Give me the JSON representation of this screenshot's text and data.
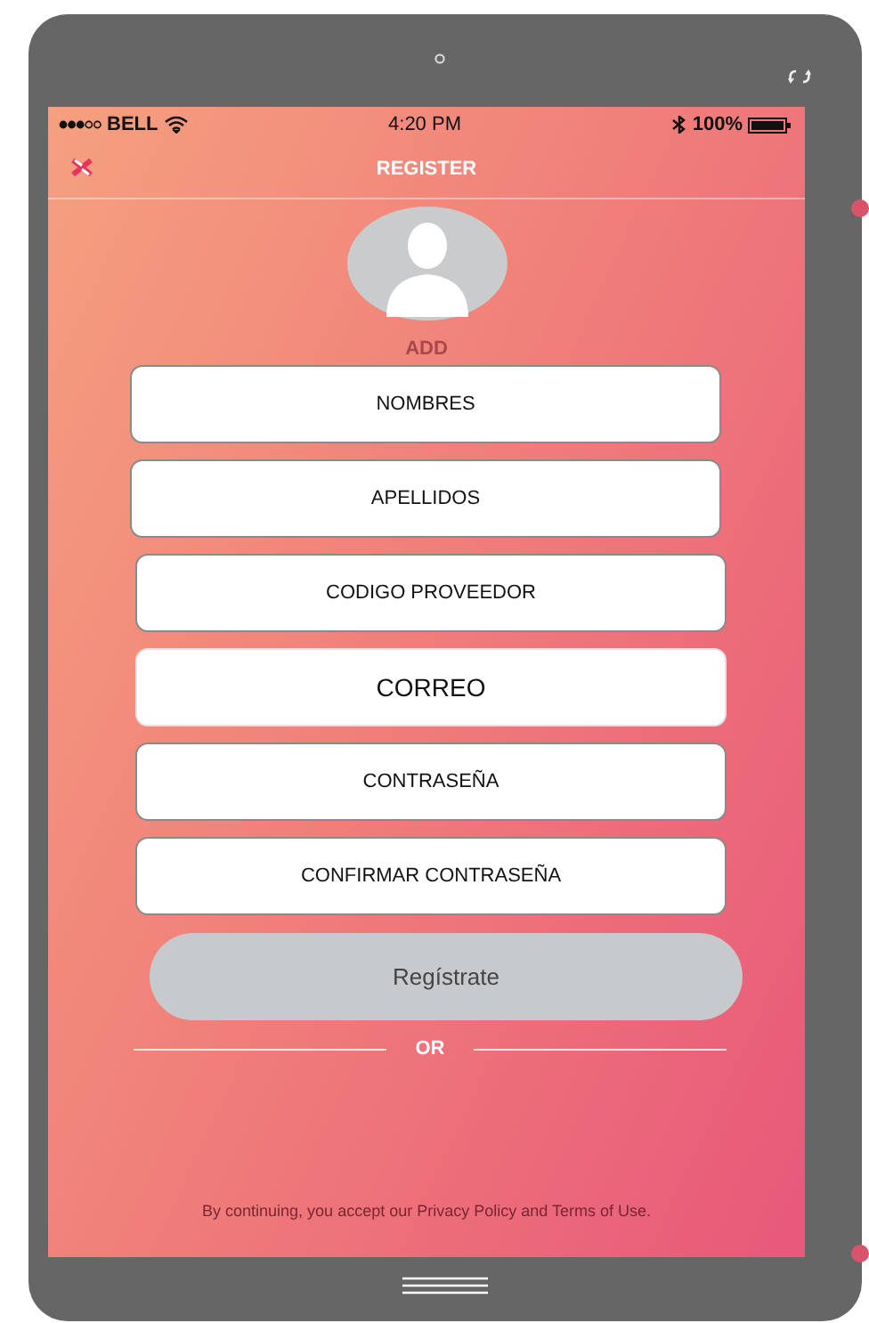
{
  "status_bar": {
    "carrier": "BELL",
    "time": "4:20 PM",
    "battery": "100%"
  },
  "nav": {
    "title": "REGISTER"
  },
  "avatar": {
    "caption": "ADD"
  },
  "fields": [
    {
      "placeholder": "NOMBRES",
      "kind": "standard"
    },
    {
      "placeholder": "APELLIDOS",
      "kind": "standard"
    },
    {
      "placeholder": "CODIGO PROVEEDOR",
      "kind": "standard"
    },
    {
      "placeholder": "CORREO",
      "kind": "large"
    },
    {
      "placeholder": "CONTRASEÑA",
      "kind": "standard"
    },
    {
      "placeholder": "CONFIRMAR CONTRASEÑA",
      "kind": "standard"
    }
  ],
  "submit_button": "Regístrate",
  "divider": "OR",
  "footer": "By continuing, you accept our Privacy Policy and Terms of Use."
}
